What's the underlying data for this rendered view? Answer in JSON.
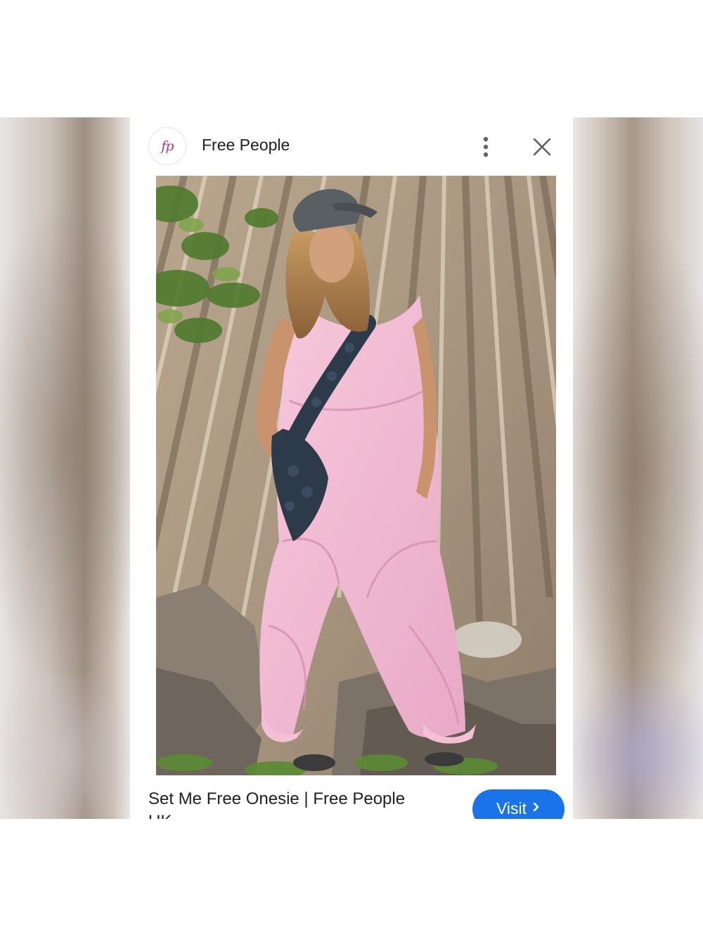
{
  "sheet": {
    "brand_logo_text": "fp",
    "brand_name": "Free People",
    "icons": {
      "more": "more-vertical-icon",
      "close": "close-icon"
    }
  },
  "result": {
    "title": "Set Me Free Onesie | Free People",
    "source_partial": "UK",
    "visit_label": "Visit",
    "visit_icon": "chevron-right-icon"
  },
  "colors": {
    "accent": "#1a73e8",
    "brand_logo": "#b8347a",
    "text": "#202124"
  }
}
